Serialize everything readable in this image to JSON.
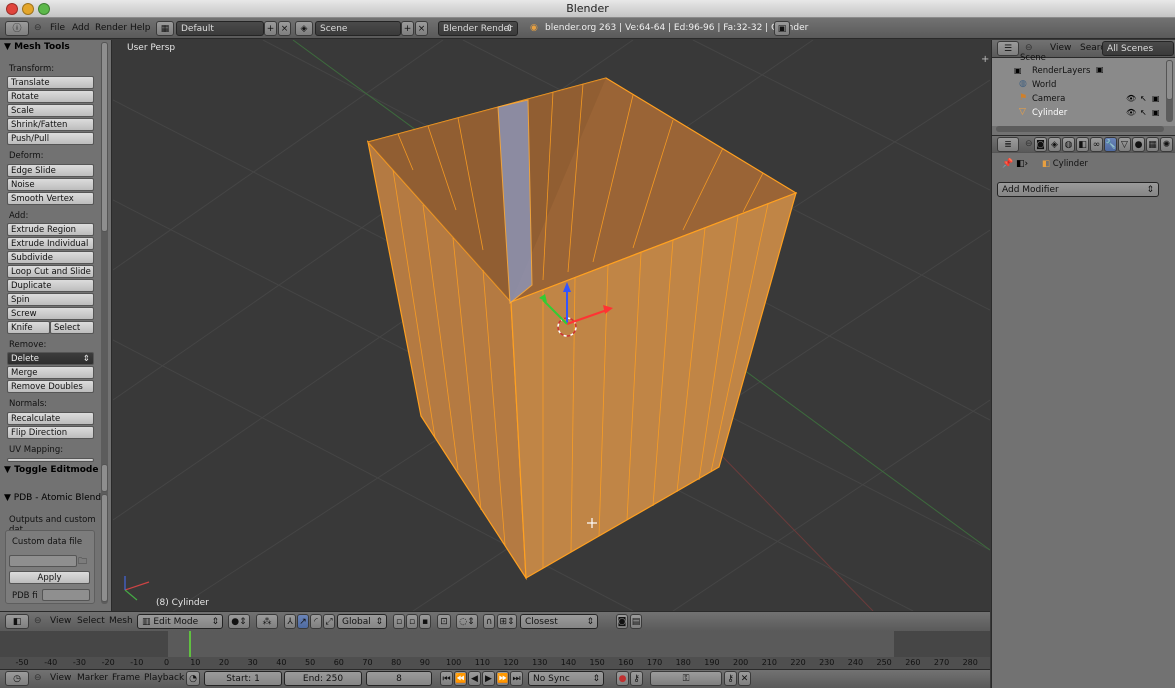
{
  "window": {
    "title": "Blender"
  },
  "topbar": {
    "menus": [
      "File",
      "Add",
      "Render",
      "Help"
    ],
    "layout": "Default",
    "scene": "Scene",
    "render_engine": "Blender Render",
    "info": "blender.org 263 | Ve:64-64 | Ed:96-96 | Fa:32-32 | Cylinder"
  },
  "toolshelf": {
    "mesh_tools_title": "Mesh Tools",
    "transform_label": "Transform:",
    "transform": [
      "Translate",
      "Rotate",
      "Scale",
      "Shrink/Fatten",
      "Push/Pull"
    ],
    "deform_label": "Deform:",
    "deform": [
      "Edge Slide",
      "Noise",
      "Smooth Vertex"
    ],
    "add_label": "Add:",
    "add": [
      "Extrude Region",
      "Extrude Individual",
      "Subdivide",
      "Loop Cut and Slide",
      "Duplicate",
      "Spin",
      "Screw"
    ],
    "knife": "Knife",
    "select": "Select",
    "remove_label": "Remove:",
    "delete": "Delete",
    "merge": "Merge",
    "remove_doubles": "Remove Doubles",
    "normals_label": "Normals:",
    "recalculate": "Recalculate",
    "flip_direction": "Flip Direction",
    "uv_label": "UV Mapping:",
    "toggle_editmode": "Toggle Editmode",
    "pdb_title": "PDB - Atomic Blende",
    "outputs_label": "Outputs and custom dat",
    "custom_data_label": "Custom data file",
    "apply": "Apply",
    "pdb_fi_label": "PDB fi"
  },
  "viewport": {
    "view_label": "User Persp",
    "object_label": "(8) Cylinder",
    "header": {
      "menus": [
        "View",
        "Select",
        "Mesh"
      ],
      "mode": "Edit Mode",
      "orientation": "Global",
      "snap": "Closest"
    }
  },
  "outliner": {
    "menus": [
      "View",
      "Search"
    ],
    "scope": "All Scenes",
    "items": [
      "Scene",
      "RenderLayers",
      "World",
      "Camera",
      "Cylinder"
    ]
  },
  "properties": {
    "object_name": "Cylinder",
    "add_modifier": "Add Modifier"
  },
  "timeline": {
    "ticks": [
      "-50",
      "-40",
      "-30",
      "-20",
      "-10",
      "0",
      "10",
      "20",
      "30",
      "40",
      "50",
      "60",
      "70",
      "80",
      "90",
      "100",
      "110",
      "120",
      "130",
      "140",
      "150",
      "160",
      "170",
      "180",
      "190",
      "200",
      "210",
      "220",
      "230",
      "240",
      "250",
      "260",
      "270",
      "280"
    ],
    "current_frame": 8
  },
  "status": {
    "menus": [
      "View",
      "Marker",
      "Frame",
      "Playback"
    ],
    "start": "Start: 1",
    "end": "End: 250",
    "frame": "8",
    "sync": "No Sync"
  },
  "colors": {
    "mesh_face": "#b07840",
    "mesh_edge": "#ffa020",
    "background": "#393939"
  }
}
